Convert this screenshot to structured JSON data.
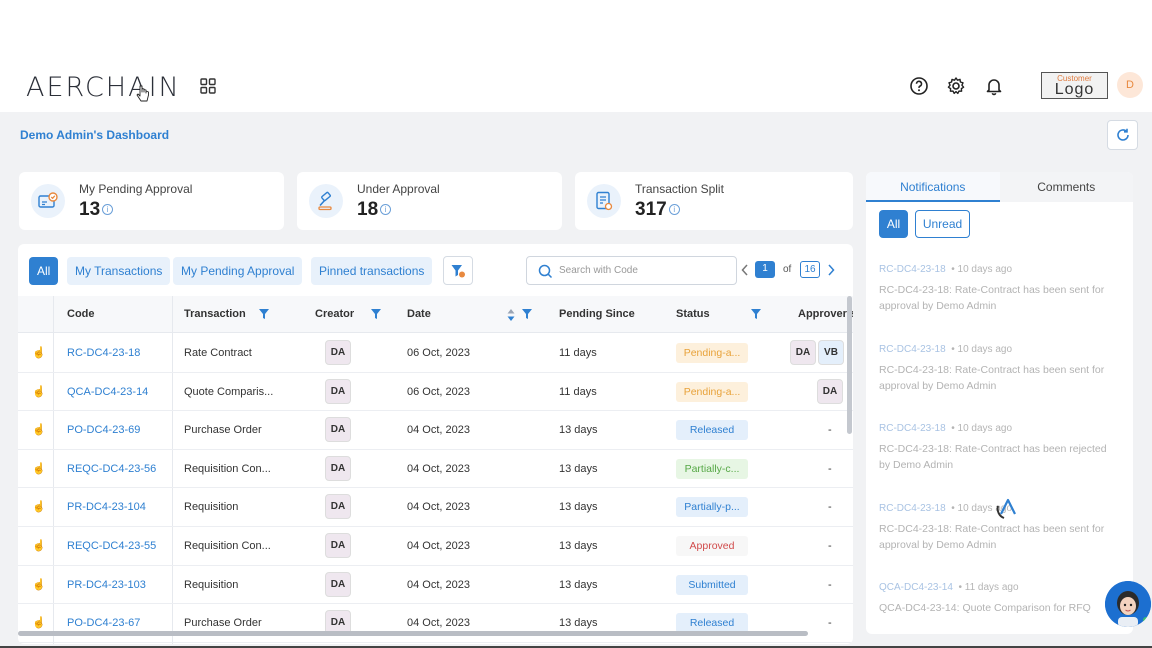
{
  "header": {
    "logo_text": "AERCHAIN",
    "customer_logo_small": "Customer",
    "customer_logo_big": "Logo",
    "avatar_initial": "D",
    "icons": [
      "apps-grid-icon",
      "help-icon",
      "settings-gear-icon",
      "notification-bell-icon"
    ]
  },
  "dashboard": {
    "title": "Demo Admin's Dashboard"
  },
  "cards": [
    {
      "label": "My Pending Approval",
      "value": "13",
      "icon": "pending-approval-icon"
    },
    {
      "label": "Under Approval",
      "value": "18",
      "icon": "gavel-icon"
    },
    {
      "label": "Transaction Split",
      "value": "317",
      "icon": "document-split-icon"
    }
  ],
  "filters": {
    "tabs": [
      "All",
      "My Transactions",
      "My Pending Approval",
      "Pinned transactions"
    ],
    "active": "All"
  },
  "search": {
    "placeholder": "Search with Code"
  },
  "pagination": {
    "current": "1",
    "of_label": "of",
    "total": "16"
  },
  "table": {
    "columns": [
      "Code",
      "Transaction",
      "Creator",
      "Date",
      "Pending Since",
      "Status",
      "Approver(s"
    ],
    "rows": [
      {
        "code": "RC-DC4-23-18",
        "transaction": "Rate Contract",
        "creator": "DA",
        "date": "06 Oct, 2023",
        "pending": "11 days",
        "status": "Pending-a...",
        "status_type": "pending",
        "approvers": [
          "DA",
          "VB"
        ]
      },
      {
        "code": "QCA-DC4-23-14",
        "transaction": "Quote Comparis...",
        "creator": "DA",
        "date": "06 Oct, 2023",
        "pending": "11 days",
        "status": "Pending-a...",
        "status_type": "pending",
        "approvers": [
          "DA"
        ]
      },
      {
        "code": "PO-DC4-23-69",
        "transaction": "Purchase Order",
        "creator": "DA",
        "date": "04 Oct, 2023",
        "pending": "13 days",
        "status": "Released",
        "status_type": "released",
        "approvers": [
          "-"
        ]
      },
      {
        "code": "REQC-DC4-23-56",
        "transaction": "Requisition Con...",
        "creator": "DA",
        "date": "04 Oct, 2023",
        "pending": "13 days",
        "status": "Partially-c...",
        "status_type": "partc",
        "approvers": [
          "-"
        ]
      },
      {
        "code": "PR-DC4-23-104",
        "transaction": "Requisition",
        "creator": "DA",
        "date": "04 Oct, 2023",
        "pending": "13 days",
        "status": "Partially-p...",
        "status_type": "partp",
        "approvers": [
          "-"
        ]
      },
      {
        "code": "REQC-DC4-23-55",
        "transaction": "Requisition Con...",
        "creator": "DA",
        "date": "04 Oct, 2023",
        "pending": "13 days",
        "status": "Approved",
        "status_type": "approved",
        "approvers": [
          "-"
        ]
      },
      {
        "code": "PR-DC4-23-103",
        "transaction": "Requisition",
        "creator": "DA",
        "date": "04 Oct, 2023",
        "pending": "13 days",
        "status": "Submitted",
        "status_type": "submitted",
        "approvers": [
          "-"
        ]
      },
      {
        "code": "PO-DC4-23-67",
        "transaction": "Purchase Order",
        "creator": "DA",
        "date": "04 Oct, 2023",
        "pending": "13 days",
        "status": "Released",
        "status_type": "released",
        "approvers": [
          "-"
        ]
      }
    ]
  },
  "notifications_panel": {
    "tabs": [
      "Notifications",
      "Comments"
    ],
    "filter_buttons": [
      "All",
      "Unread"
    ],
    "items": [
      {
        "code": "RC-DC4-23-18",
        "ago": "10 days ago",
        "message": "RC-DC4-23-18: Rate-Contract has been sent for approval by Demo Admin"
      },
      {
        "code": "RC-DC4-23-18",
        "ago": "10 days ago",
        "message": "RC-DC4-23-18: Rate-Contract has been sent for approval by Demo Admin"
      },
      {
        "code": "RC-DC4-23-18",
        "ago": "10 days ago",
        "message": "RC-DC4-23-18: Rate-Contract has been rejected by Demo Admin"
      },
      {
        "code": "RC-DC4-23-18",
        "ago": "10 days ago",
        "message": "RC-DC4-23-18: Rate-Contract has been sent for approval by Demo Admin"
      },
      {
        "code": "QCA-DC4-23-14",
        "ago": "11 days ago",
        "message": "QCA-DC4-23-14: Quote Comparison for RFQ"
      }
    ]
  },
  "colors": {
    "accent": "#2f80d1",
    "pending": "#e8a23a",
    "approved": "#d14b4b",
    "partially_completed": "#56a846"
  }
}
